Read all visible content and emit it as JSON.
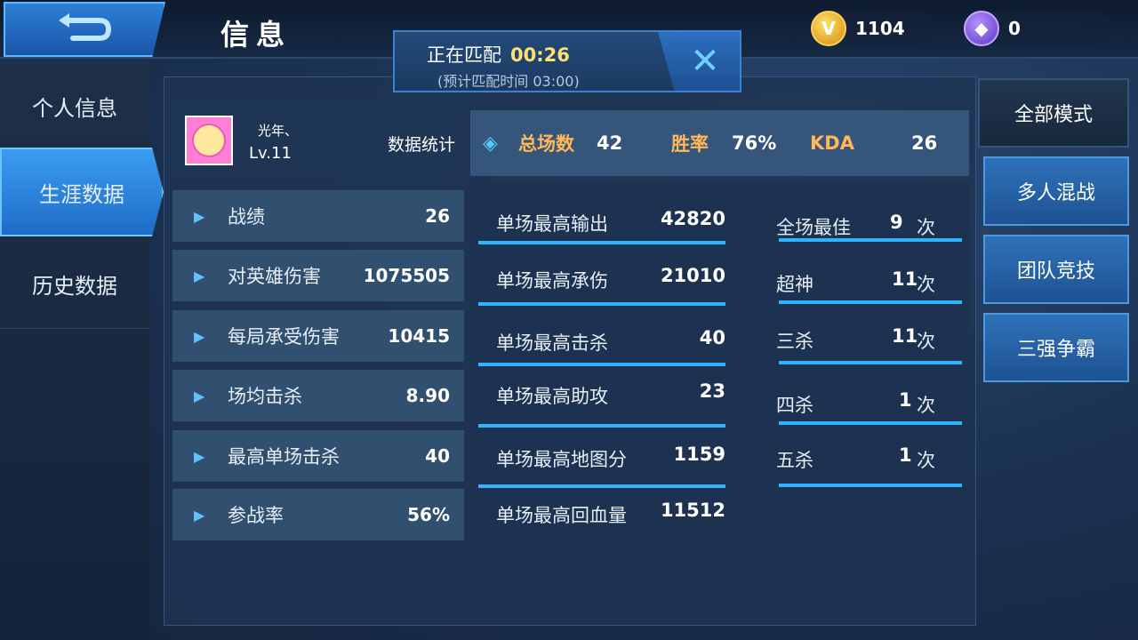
{
  "header": {
    "title": "信息",
    "gold_coins": "1104",
    "gems": "0"
  },
  "match": {
    "status": "正在匹配",
    "timer": "00:26",
    "estimate": "(预计匹配时间 03:00)"
  },
  "sidebar": {
    "items": [
      {
        "label": "个人信息"
      },
      {
        "label": "生涯数据"
      },
      {
        "label": "历史数据"
      }
    ]
  },
  "profile": {
    "name": "光年、",
    "level": "Lv.11",
    "stats_label": "数据统计"
  },
  "left_stats": [
    {
      "label": "战绩",
      "value": "26"
    },
    {
      "label": "对英雄伤害",
      "value": "1075505"
    },
    {
      "label": "每局承受伤害",
      "value": "10415"
    },
    {
      "label": "场均击杀",
      "value": "8.90"
    },
    {
      "label": "最高单场击杀",
      "value": "40"
    },
    {
      "label": "参战率",
      "value": "56%"
    }
  ],
  "summary": {
    "total_label": "总场数",
    "total_value": "42",
    "winrate_label": "胜率",
    "winrate_value": "76%",
    "kda_label": "KDA",
    "kda_value": "26"
  },
  "records": [
    {
      "label": "单场最高输出",
      "value": "42820"
    },
    {
      "label": "单场最高承伤",
      "value": "21010"
    },
    {
      "label": "单场最高击杀",
      "value": "40"
    },
    {
      "label": "单场最高助攻",
      "value": "23"
    },
    {
      "label": "单场最高地图分",
      "value": "1159"
    },
    {
      "label": "单场最高回血量",
      "value": "11512"
    }
  ],
  "honors": [
    {
      "label": "全场最佳",
      "value": "9",
      "unit": "次"
    },
    {
      "label": "超神",
      "value": "11",
      "unit": "次"
    },
    {
      "label": "三杀",
      "value": "11",
      "unit": "次"
    },
    {
      "label": "四杀",
      "value": "1",
      "unit": "次"
    },
    {
      "label": "五杀",
      "value": "1",
      "unit": "次"
    }
  ],
  "modes": [
    {
      "label": "全部模式"
    },
    {
      "label": "多人混战"
    },
    {
      "label": "团队竞技"
    },
    {
      "label": "三强争霸"
    }
  ]
}
